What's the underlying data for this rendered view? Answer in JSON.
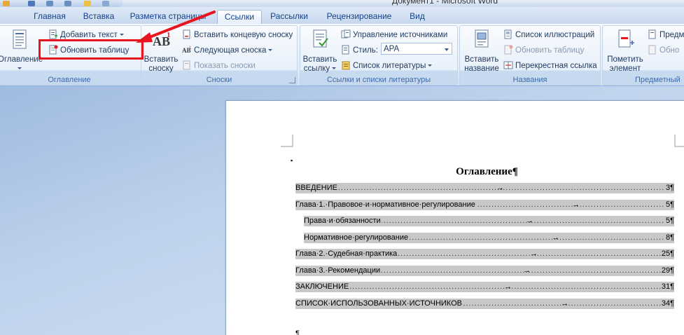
{
  "window": {
    "title": "Документ1 - Microsoft Word"
  },
  "tabs": [
    {
      "label": "Главная"
    },
    {
      "label": "Вставка"
    },
    {
      "label": "Разметка страницы"
    },
    {
      "label": "Ссылки",
      "active": true
    },
    {
      "label": "Рассылки"
    },
    {
      "label": "Рецензирование"
    },
    {
      "label": "Вид"
    }
  ],
  "ribbon": {
    "toc_group": {
      "label": "Оглавление",
      "big_button": "Оглавление",
      "add_text": "Добавить текст",
      "update_table": "Обновить таблицу"
    },
    "footnotes_group": {
      "label": "Сноски",
      "insert_footnote": [
        "Вставить",
        "сноску"
      ],
      "insert_endnote": "Вставить концевую сноску",
      "next_footnote": "Следующая сноска",
      "show_notes": "Показать сноски"
    },
    "citations_group": {
      "label": "Ссылки и списки литературы",
      "insert_citation": [
        "Вставить",
        "ссылку"
      ],
      "manage_sources": "Управление источниками",
      "style_label": "Стиль:",
      "style_value": "APA",
      "bibliography": "Список литературы"
    },
    "captions_group": {
      "label": "Названия",
      "insert_caption": [
        "Вставить",
        "название"
      ],
      "table_of_figures": "Список иллюстраций",
      "update_table": "Обновить таблицу",
      "cross_reference": "Перекрестная ссылка"
    },
    "index_group": {
      "label": "Предметный",
      "mark_entry": [
        "Пометить",
        "элемент"
      ],
      "insert_index": "Предм",
      "update_index": "Обно"
    }
  },
  "document": {
    "title": "Оглавление¶",
    "toc": [
      {
        "label": "ВВЕДЕНИЕ",
        "page": "3¶",
        "indent": 0,
        "arrow": 0.53
      },
      {
        "label": "Глава·1.·Правовое·и·нормативное·регулирование",
        "page": "5¶",
        "indent": 0,
        "arrow": 0.73
      },
      {
        "label": "Права·и·обязанности",
        "page": "5¶",
        "indent": 1,
        "arrow": 0.6
      },
      {
        "label": "Нормативное·регулирование",
        "page": "8¶",
        "indent": 1,
        "arrow": 0.67
      },
      {
        "label": "Глава·2.·Судебная·практика",
        "page": "25¶",
        "indent": 0,
        "arrow": 0.62
      },
      {
        "label": "Глава·3.·Рекомендации",
        "page": "29¶",
        "indent": 0,
        "arrow": 0.6
      },
      {
        "label": "ЗАКЛЮЧЕНИЕ",
        "page": "31¶",
        "indent": 0,
        "arrow": 0.55
      },
      {
        "label": "СПИСОК·ИСПОЛЬЗОВАННЫХ·ИСТОЧНИКОВ",
        "page": "34¶",
        "indent": 0,
        "arrow": 0.7
      }
    ],
    "end_mark": "¶",
    "bullet_mark": "▪"
  },
  "colors": {
    "annotation_red": "#e8141e",
    "toc_field_shade": "#c8c8c8",
    "ribbon_text": "#1e3a5f"
  }
}
